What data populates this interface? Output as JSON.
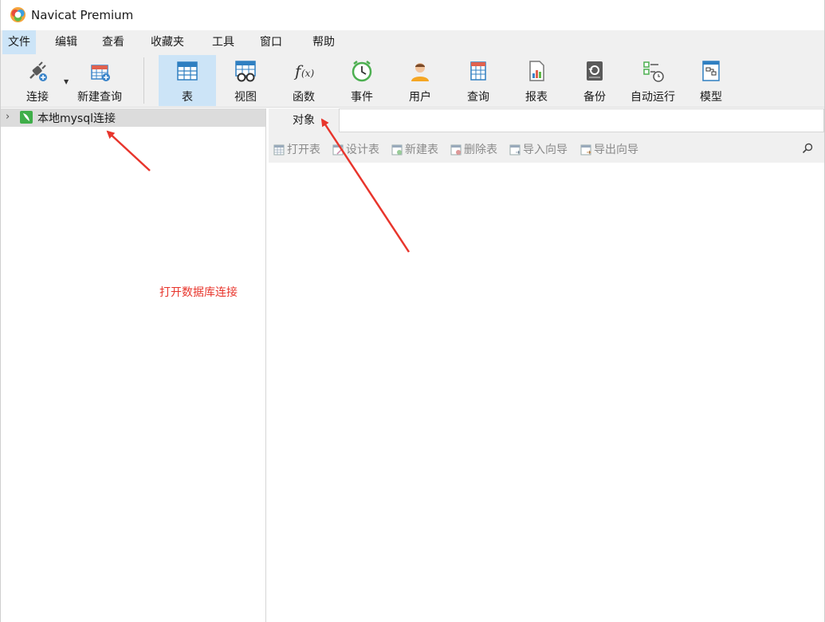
{
  "window": {
    "title": "Navicat Premium"
  },
  "menu": {
    "items": [
      {
        "label": "文件",
        "active": true
      },
      {
        "label": "编辑"
      },
      {
        "label": "查看"
      },
      {
        "label": "收藏夹"
      },
      {
        "label": "工具"
      },
      {
        "label": "窗口"
      },
      {
        "label": "帮助"
      }
    ]
  },
  "toolbar": {
    "connect": "连接",
    "new_query": "新建查询",
    "table": "表",
    "view": "视图",
    "function": "函数",
    "event": "事件",
    "user": "用户",
    "query": "查询",
    "report": "报表",
    "backup": "备份",
    "schedule": "自动运行",
    "model": "模型",
    "active": "table"
  },
  "navigator": {
    "connection_label": "本地mysql连接"
  },
  "annotation": {
    "text": "打开数据库连接",
    "color": "#e8352c"
  },
  "objects": {
    "tab_label": "对象",
    "toolbar": {
      "open_table": "打开表",
      "design_table": "设计表",
      "new_table": "新建表",
      "delete_table": "删除表",
      "import_wizard": "导入向导",
      "export_wizard": "导出向导"
    }
  },
  "colors": {
    "accent": "#cce4f7",
    "toolbar_bg": "#f0f0f0",
    "disabled_text": "#8a8a8a",
    "annotation": "#e8352c"
  }
}
